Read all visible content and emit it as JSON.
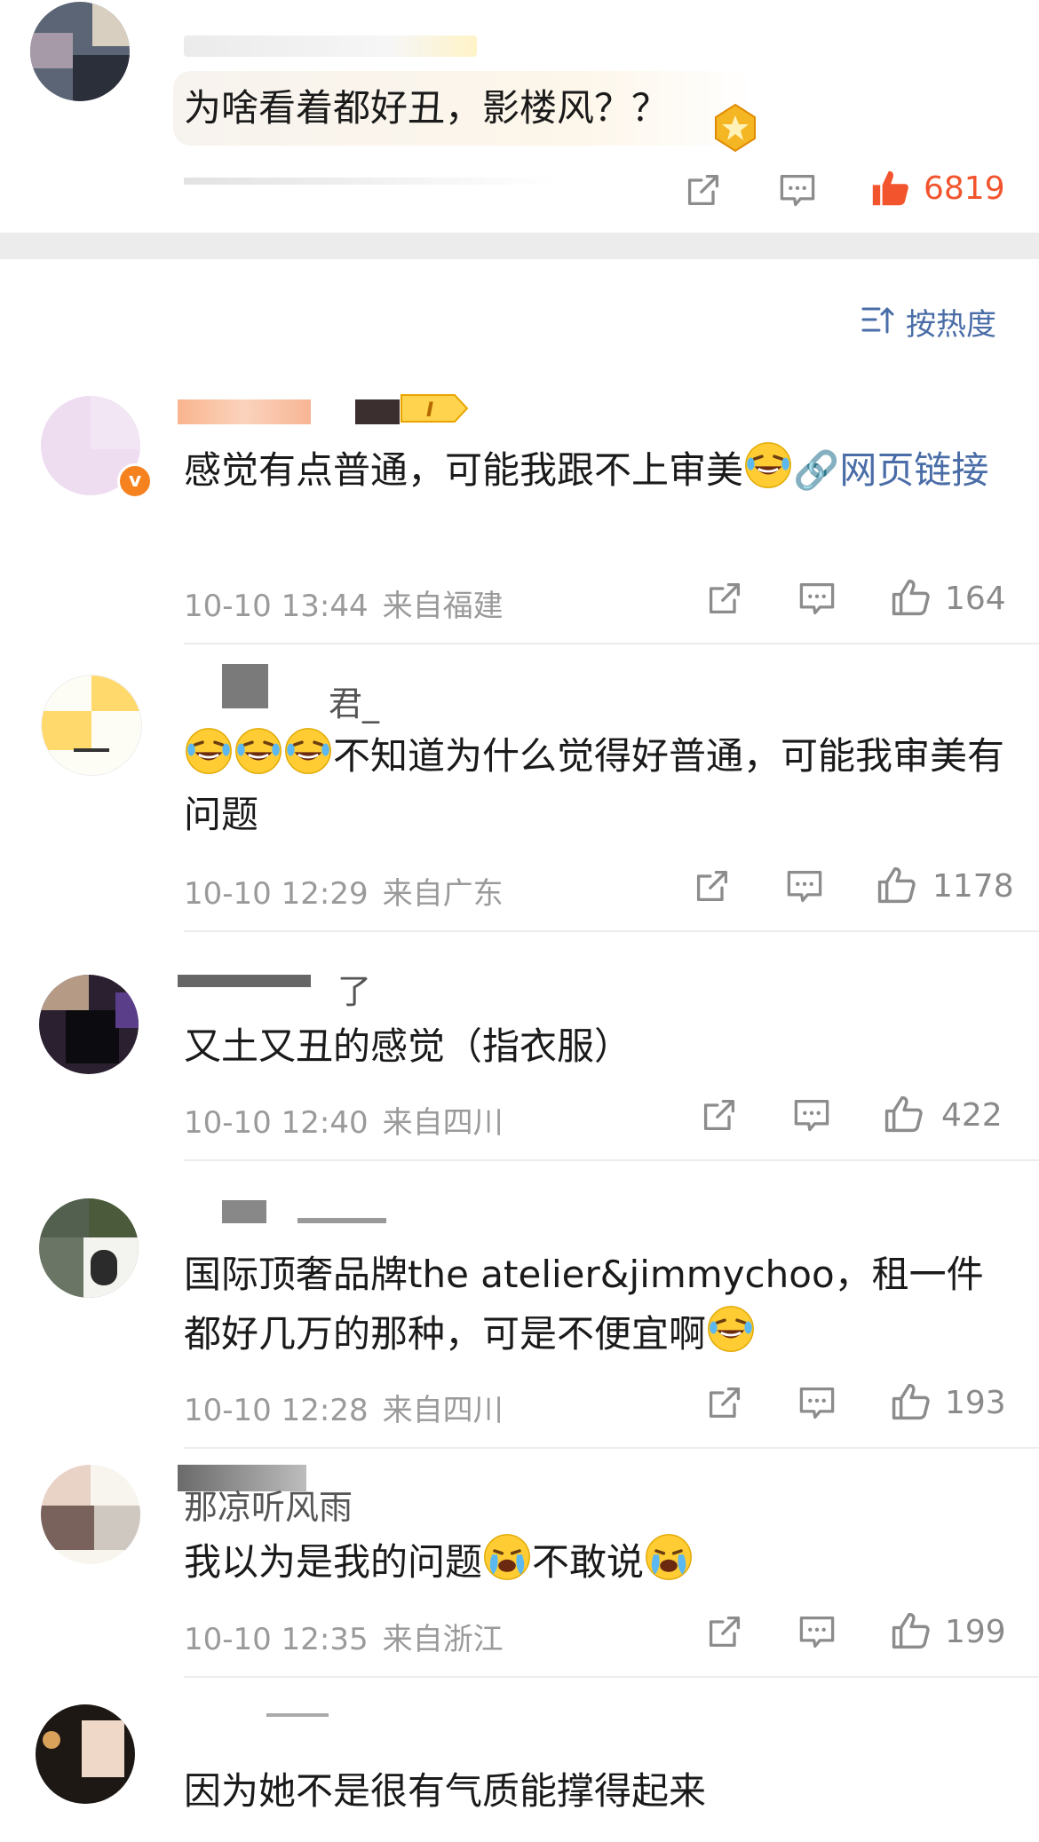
{
  "top_comment": {
    "text": "为啥看着都好丑，影楼风？？",
    "likes": "6819"
  },
  "sort": {
    "label": "按热度"
  },
  "comments": [
    {
      "text": "感觉有点普通，可能我跟不上审美",
      "link": "网页链接",
      "time": "10-10 13:44",
      "location": "来自福建",
      "likes": "164"
    },
    {
      "name": "君_",
      "text": "不知道为什么觉得好普通，可能我审美有问题",
      "time": "10-10 12:29",
      "location": "来自广东",
      "likes": "1178"
    },
    {
      "name": "了",
      "text": "又土又丑的感觉（指衣服）",
      "time": "10-10 12:40",
      "location": "来自四川",
      "likes": "422"
    },
    {
      "text": "国际顶奢品牌the atelier&jimmychoo，租一件都好几万的那种，可是不便宜啊",
      "time": "10-10 12:28",
      "location": "来自四川",
      "likes": "193"
    },
    {
      "name": "那凉听风雨",
      "text_a": "我以为是我的问题",
      "text_b": "不敢说",
      "time": "10-10 12:35",
      "location": "来自浙江",
      "likes": "199"
    },
    {
      "text": "因为她不是很有气质能撑得起来"
    }
  ],
  "colors": {
    "like_active": "#f2542d",
    "meta": "#9a9a9a",
    "link": "#4a6da7",
    "separator_band": "#ececec"
  }
}
